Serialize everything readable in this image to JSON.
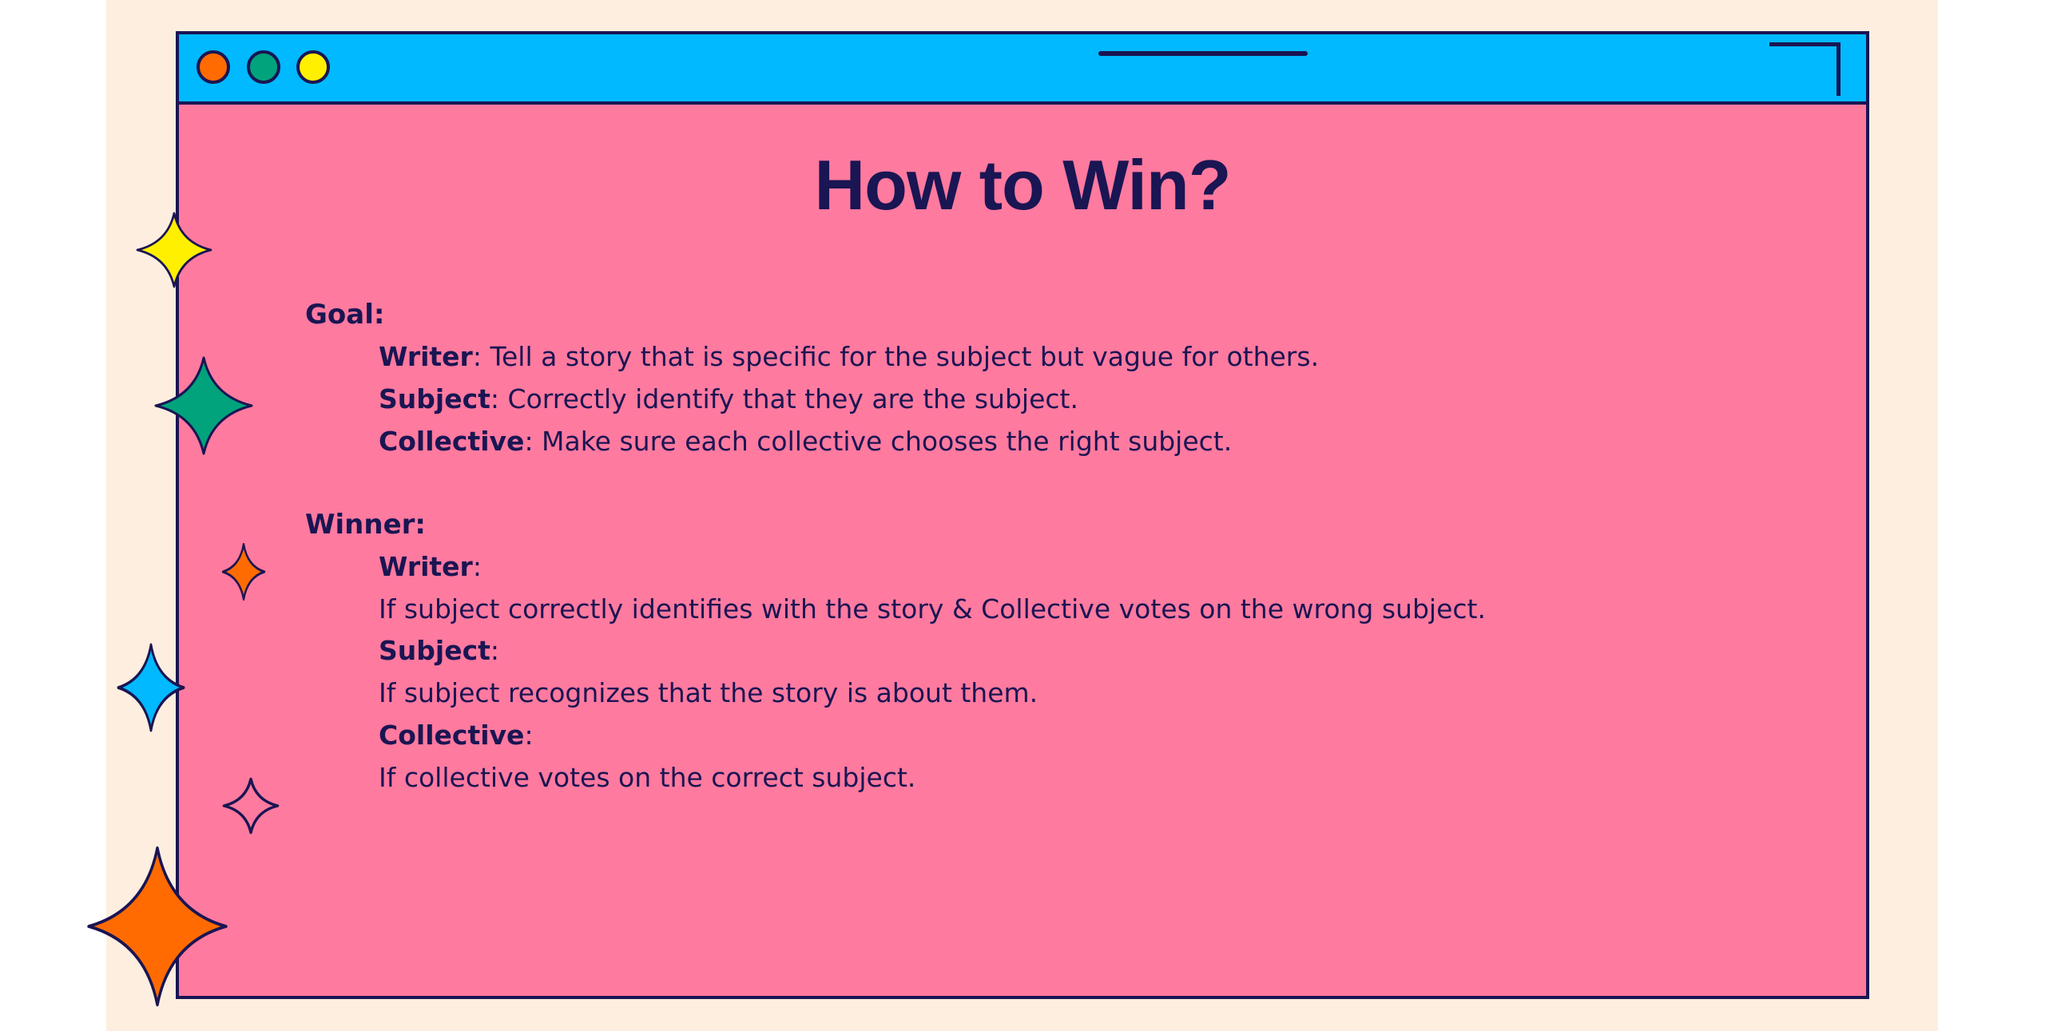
{
  "slide": {
    "title": "How to Win?",
    "goal": {
      "heading": "Goal:",
      "items": [
        {
          "role": "Writer",
          "sep": ":",
          "text": " Tell a story that is specific for the subject but vague for others."
        },
        {
          "role": "Subject",
          "sep": ":",
          "text": " Correctly identify that they are the subject."
        },
        {
          "role": "Collective",
          "sep": ":",
          "text": " Make sure each collective chooses the right subject."
        }
      ]
    },
    "winner": {
      "heading": "Winner:",
      "items": [
        {
          "role": "Writer",
          "sep": ":",
          "condition": "If subject correctly identifies with the story & Collective votes on the wrong subject."
        },
        {
          "role": "Subject",
          "sep": ":",
          "condition": "If subject recognizes that the story is about them."
        },
        {
          "role": "Collective",
          "sep": ":",
          "condition": "If collective votes on the correct subject."
        }
      ]
    }
  },
  "colors": {
    "background": "#fdeee0",
    "window_fill": "#ff7a9f",
    "titlebar": "#00b9ff",
    "outline": "#1a1553",
    "dots": [
      "#ff6b00",
      "#00a37c",
      "#fff000"
    ],
    "sparkles": [
      "#fff000",
      "#00a37c",
      "#ff6b00",
      "#00b9ff",
      "#ff7a9f",
      "#ff6b00"
    ]
  },
  "icons": [
    "sparkle-icon"
  ]
}
